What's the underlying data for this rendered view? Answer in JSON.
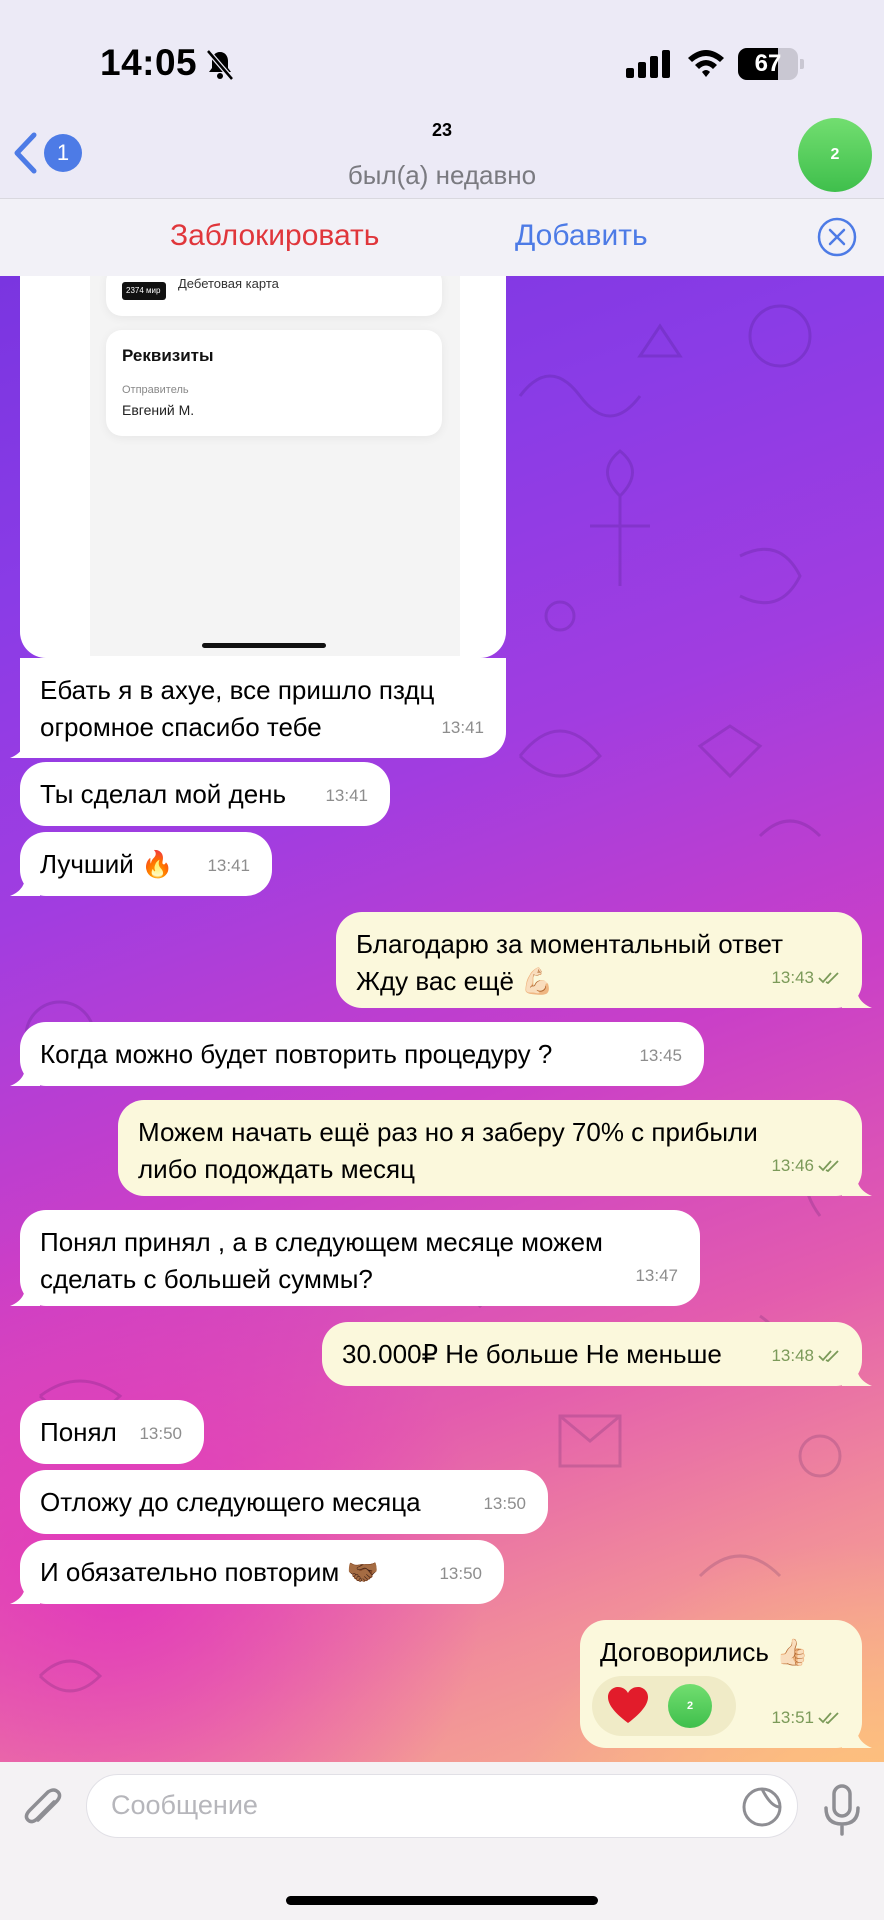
{
  "status_bar": {
    "time": "14:05",
    "battery": "67",
    "battery_level": 0.67
  },
  "header": {
    "back_count": "1",
    "title": "23",
    "status": "был(а) недавно",
    "avatar_text": "2",
    "avatar_color": "#4fca55"
  },
  "actions": {
    "block_label": "Заблокировать",
    "add_label": "Добавить"
  },
  "screenshot": {
    "card_badge": "2374 мир",
    "card_type": "Дебетовая карта",
    "details_title": "Реквизиты",
    "sender_label": "Отправитель",
    "sender_value": "Евгений М."
  },
  "messages": [
    {
      "dir": "in",
      "line1": "Ебать я в ахуе, все пришло пздц",
      "line2": "огромное спасибо тебе",
      "time": "13:41"
    },
    {
      "dir": "in",
      "text": "Ты сделал мой день",
      "time": "13:41"
    },
    {
      "dir": "in",
      "text": "Лучший 🔥",
      "time": "13:41"
    },
    {
      "dir": "out",
      "line1": "Благодарю за моментальный ответ",
      "line2": "Жду вас ещё 💪🏻",
      "time": "13:43"
    },
    {
      "dir": "in",
      "text": "Когда можно будет повторить процедуру ?",
      "time": "13:45"
    },
    {
      "dir": "out",
      "line1": "Можем начать ещё раз но я заберу 70% с прибыли",
      "line2": "либо подождать месяц",
      "time": "13:46"
    },
    {
      "dir": "in",
      "line1": "Понял принял , а в следующем месяце можем",
      "line2": "сделать с большей суммы?",
      "time": "13:47"
    },
    {
      "dir": "out",
      "text": "30.000₽ Не больше Не меньше",
      "time": "13:48"
    },
    {
      "dir": "in",
      "text": "Понял",
      "time": "13:50"
    },
    {
      "dir": "in",
      "text": "Отложу до следующего месяца",
      "time": "13:50"
    },
    {
      "dir": "in",
      "text": "И обязательно повторим 🤝🏾",
      "time": "13:50"
    },
    {
      "dir": "out",
      "text": "Договорились 👍🏻",
      "time": "13:51",
      "reaction": "❤️",
      "reaction_avatar": "2"
    }
  ],
  "input": {
    "placeholder": "Сообщение"
  },
  "colors": {
    "incoming_bubble": "#ffffff",
    "outgoing_bubble": "#fbf8dc",
    "accent_blue": "#4d7be6",
    "block_red": "#e0363b"
  }
}
